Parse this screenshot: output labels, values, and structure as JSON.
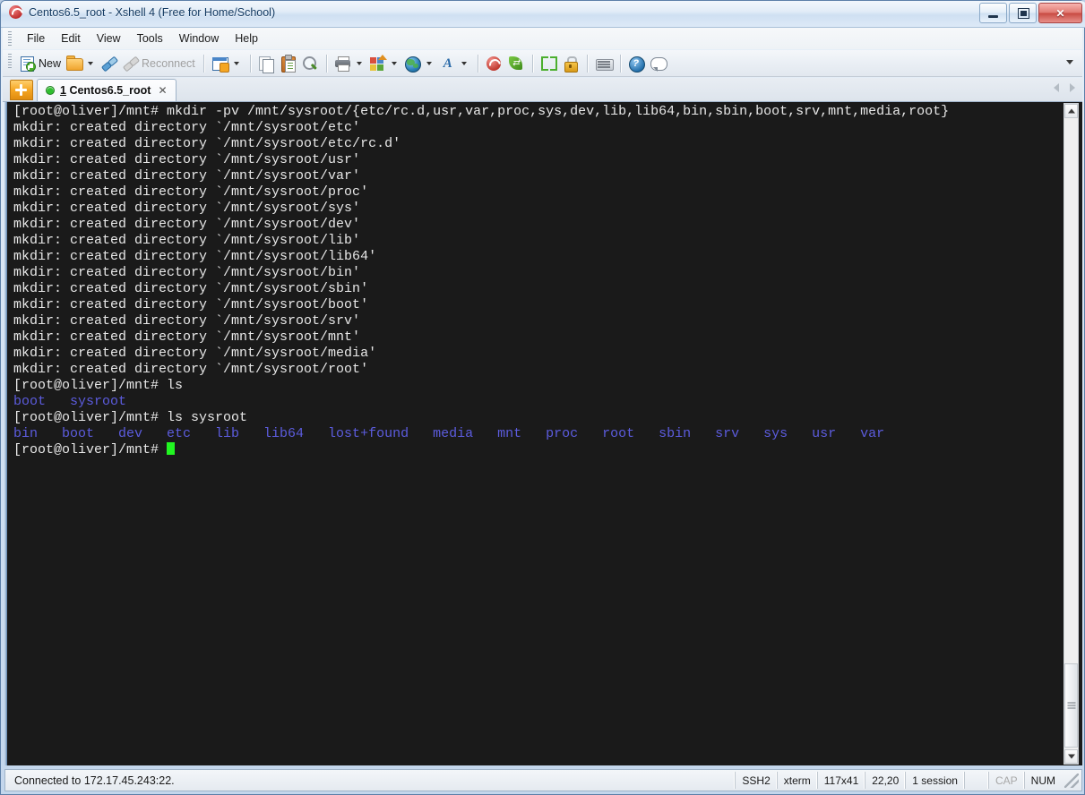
{
  "window": {
    "title": "Centos6.5_root - Xshell 4 (Free for Home/School)",
    "app_icon": "xshell-logo-icon",
    "controls": {
      "minimize": "minimize",
      "restore": "restore",
      "close": "✕"
    }
  },
  "menubar": {
    "items": [
      {
        "label": "File",
        "name": "menu-file"
      },
      {
        "label": "Edit",
        "name": "menu-edit"
      },
      {
        "label": "View",
        "name": "menu-view"
      },
      {
        "label": "Tools",
        "name": "menu-tools"
      },
      {
        "label": "Window",
        "name": "menu-window"
      },
      {
        "label": "Help",
        "name": "menu-help"
      }
    ]
  },
  "toolbar": {
    "new_label": "New",
    "reconnect_label": "Reconnect",
    "reconnect_disabled": true,
    "icons": [
      "new-session-icon",
      "open-folder-icon",
      "connect-icon",
      "reconnect-icon",
      "session-manager-icon",
      "copy-icon",
      "paste-icon",
      "find-icon",
      "print-icon",
      "layout-icon",
      "globe-icon",
      "font-icon",
      "xshell-icon",
      "xftp-icon",
      "fullscreen-icon",
      "lock-icon",
      "keyboard-icon",
      "help-icon",
      "chat-icon"
    ],
    "overflow": "toolbar-overflow-chevron"
  },
  "tabbar": {
    "new_tab": "+",
    "tabs": [
      {
        "index": "1",
        "title": "Centos6.5_root",
        "close": "✕",
        "status": "connected"
      }
    ]
  },
  "terminal": {
    "colors": {
      "background": "#1a1a1a",
      "foreground": "#e8e8e8",
      "directory": "#5c5cde",
      "cursor": "#21f521"
    },
    "lines": [
      {
        "text": "[root@oliver]/mnt# mkdir -pv /mnt/sysroot/{etc/rc.d,usr,var,proc,sys,dev,lib,lib64,bin,sbin,boot,srv,mnt,media,root}",
        "style": "normal"
      },
      {
        "text": "mkdir: created directory `/mnt/sysroot/etc'",
        "style": "normal"
      },
      {
        "text": "mkdir: created directory `/mnt/sysroot/etc/rc.d'",
        "style": "normal"
      },
      {
        "text": "mkdir: created directory `/mnt/sysroot/usr'",
        "style": "normal"
      },
      {
        "text": "mkdir: created directory `/mnt/sysroot/var'",
        "style": "normal"
      },
      {
        "text": "mkdir: created directory `/mnt/sysroot/proc'",
        "style": "normal"
      },
      {
        "text": "mkdir: created directory `/mnt/sysroot/sys'",
        "style": "normal"
      },
      {
        "text": "mkdir: created directory `/mnt/sysroot/dev'",
        "style": "normal"
      },
      {
        "text": "mkdir: created directory `/mnt/sysroot/lib'",
        "style": "normal"
      },
      {
        "text": "mkdir: created directory `/mnt/sysroot/lib64'",
        "style": "normal"
      },
      {
        "text": "mkdir: created directory `/mnt/sysroot/bin'",
        "style": "normal"
      },
      {
        "text": "mkdir: created directory `/mnt/sysroot/sbin'",
        "style": "normal"
      },
      {
        "text": "mkdir: created directory `/mnt/sysroot/boot'",
        "style": "normal"
      },
      {
        "text": "mkdir: created directory `/mnt/sysroot/srv'",
        "style": "normal"
      },
      {
        "text": "mkdir: created directory `/mnt/sysroot/mnt'",
        "style": "normal"
      },
      {
        "text": "mkdir: created directory `/mnt/sysroot/media'",
        "style": "normal"
      },
      {
        "text": "mkdir: created directory `/mnt/sysroot/root'",
        "style": "normal"
      },
      {
        "text": "[root@oliver]/mnt# ls",
        "style": "normal"
      },
      {
        "text": "boot   sysroot",
        "style": "blue"
      },
      {
        "text": "[root@oliver]/mnt# ls sysroot",
        "style": "normal"
      },
      {
        "text": "bin   boot   dev   etc   lib   lib64   lost+found   media   mnt   proc   root   sbin   srv   sys   usr   var",
        "style": "blue"
      },
      {
        "text": "[root@oliver]/mnt# ",
        "style": "prompt-cursor"
      }
    ]
  },
  "statusbar": {
    "message": "Connected to 172.17.45.243:22.",
    "cells": [
      {
        "label": "SSH2",
        "name": "status-protocol",
        "dim": false
      },
      {
        "label": "xterm",
        "name": "status-terminal-type",
        "dim": false
      },
      {
        "label": "117x41",
        "name": "status-size",
        "dim": false
      },
      {
        "label": "22,20",
        "name": "status-cursor-position",
        "dim": false
      },
      {
        "label": "1 session",
        "name": "status-session-count",
        "dim": false
      },
      {
        "label": "",
        "name": "status-spacer",
        "dim": false
      },
      {
        "label": "CAP",
        "name": "status-caps-lock",
        "dim": true
      },
      {
        "label": "NUM",
        "name": "status-num-lock",
        "dim": false
      }
    ]
  }
}
